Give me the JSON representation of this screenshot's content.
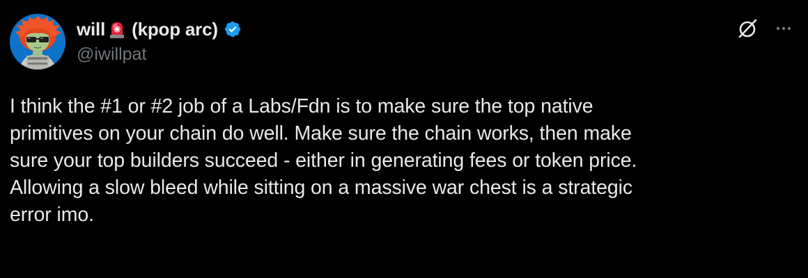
{
  "author": {
    "name_prefix": "will",
    "name_suffix": "(kpop arc)",
    "handle": "@iwillpat",
    "verified": true,
    "emoji": "siren-icon"
  },
  "actions": {
    "grok_icon": "grok-slash-circle-icon",
    "more_icon": "more-horizontal-icon"
  },
  "tweet": {
    "lines": [
      "I think the #1 or #2 job of a Labs/Fdn is to make sure the top native",
      "primitives on your chain do well. Make sure the chain works, then make",
      "sure your top builders succeed - either in generating fees or token price.",
      "Allowing a slow bleed while sitting on a massive war chest is a strategic",
      "error imo."
    ]
  },
  "colors": {
    "background": "#000000",
    "text": "#e7e9ea",
    "secondary_text": "#71767b",
    "verified_blue": "#1d9bf0"
  }
}
